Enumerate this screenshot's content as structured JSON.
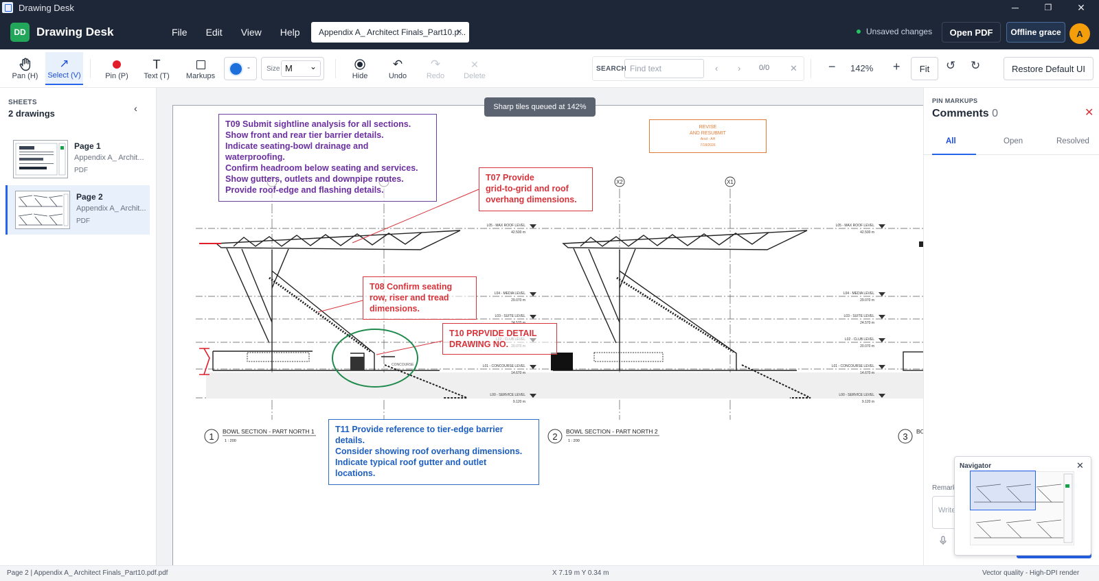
{
  "window": {
    "title": "Drawing Desk",
    "minimize": "─",
    "restore": "❐",
    "close": "✕"
  },
  "header": {
    "logo": "DD",
    "brand": "Drawing Desk",
    "menus": [
      "File",
      "Edit",
      "View",
      "Help"
    ],
    "file_tab": "Appendix A_ Architect Finals_Part10.p...",
    "file_tab_close": "×",
    "status": "Unsaved changes",
    "open_pdf": "Open PDF",
    "offline": "Offline grace",
    "avatar": "A",
    "status_color": "#22c55e",
    "accent": "#2563eb"
  },
  "toolbar": {
    "pan": "Pan (H)",
    "select": "Select (V)",
    "pin": "Pin (P)",
    "text": "Text (T)",
    "markups": "Markups",
    "color_caret": "-",
    "size_label": "Size",
    "size_value": "M",
    "hide": "Hide",
    "undo": "Undo",
    "redo": "Redo",
    "delete": "Delete",
    "search_label": "SEARCH",
    "search_placeholder": "Find text",
    "search_count": "0/0",
    "zoom_out": "−",
    "zoom": "142%",
    "zoom_in": "+",
    "fit": "Fit",
    "restore": "Restore Default UI",
    "current_color": "#1d6fdc"
  },
  "sidebar": {
    "subtitle": "SHEETS",
    "title": "2 drawings",
    "collapse": "‹",
    "sheets": [
      {
        "name": "Page 1",
        "file": "Appendix A_ Archit...",
        "type": "PDF"
      },
      {
        "name": "Page 2",
        "file": "Appendix A_ Archit...",
        "type": "PDF"
      }
    ]
  },
  "canvas": {
    "toast": "Sharp tiles queued at 142%",
    "notes": {
      "t09": [
        "T09 Submit sightline analysis for all sections.",
        "Show front and rear tier barrier details.",
        "Indicate seating-bowl drainage and",
        "waterproofing.",
        "Confirm headroom below seating and services.",
        "Show gutters, outlets and downpipe routes.",
        "Provide roof-edge and flashing details."
      ],
      "t07": [
        "T07 Provide",
        "grid-to-grid and roof",
        "overhang dimensions."
      ],
      "t08": [
        "T08 Confirm seating",
        "row, riser and tread",
        "dimensions."
      ],
      "t10": [
        "T10 PRPVIDE DETAIL",
        "DRAWING NO."
      ],
      "t11": [
        "T11 Provide reference to tier-edge barrier",
        "details.",
        "Consider showing roof overhang dimensions.",
        "Indicate typical roof gutter and outlet",
        "locations."
      ]
    },
    "stamp": {
      "line1": "REVISE",
      "line2": "AND RESUBMIT",
      "line3": "Arcd - AH",
      "line4": "7/18/2026"
    },
    "grids": [
      "X2",
      "X1"
    ],
    "levels": [
      {
        "name": "L05 - MAX ROOF LEVEL",
        "value": "42.500 m"
      },
      {
        "name": "L04 - MEDIA LEVEL",
        "value": "29.070 m"
      },
      {
        "name": "L03 - SUITE LEVEL",
        "value": "24.570 m"
      },
      {
        "name": "L02 - CLUB LEVEL",
        "value": "20.070 m"
      },
      {
        "name": "L01 - CONCOURSE LEVEL",
        "value": "14.670 m"
      },
      {
        "name": "L00 - SERVICE LEVEL",
        "value": "9.120 m"
      }
    ],
    "sections": [
      {
        "num": "1",
        "title": "BOWL SECTION - PART NORTH 1",
        "scale": "1 : 200"
      },
      {
        "num": "2",
        "title": "BOWL SECTION - PART NORTH 2",
        "scale": "1 : 200"
      },
      {
        "num": "3",
        "title": "BO"
      }
    ],
    "concourse_label": "CONCOURSE"
  },
  "comments": {
    "subtitle": "PIN MARKUPS",
    "title": "Comments",
    "count": "0",
    "close": "✕",
    "tabs": [
      "All",
      "Open",
      "Resolved"
    ],
    "remark_label": "Remark",
    "write_placeholder": "Write"
  },
  "navigator": {
    "title": "Navigator",
    "close": "✕"
  },
  "statusbar": {
    "left": "Page 2 | Appendix A_ Architect Finals_Part10.pdf.pdf",
    "coords": "X 7.19 m   Y 0.34 m",
    "right": "Vector quality - High-DPI render"
  }
}
